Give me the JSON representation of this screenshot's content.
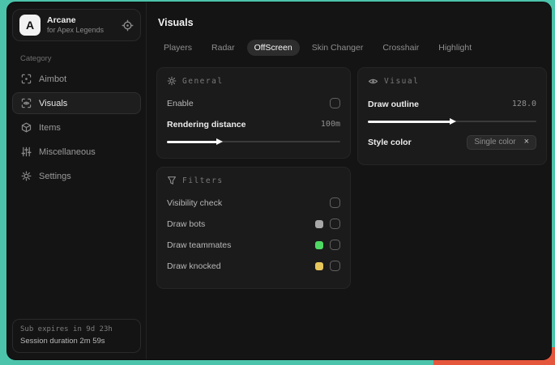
{
  "app": {
    "initial": "A",
    "name": "Arcane",
    "subtitle": "for Apex Legends",
    "header_icon": "target"
  },
  "sidebar": {
    "category_label": "Category",
    "items": [
      {
        "label": "Aimbot",
        "icon": "crosshair",
        "active": false
      },
      {
        "label": "Visuals",
        "icon": "eye-scan",
        "active": true
      },
      {
        "label": "Items",
        "icon": "cube",
        "active": false
      },
      {
        "label": "Miscellaneous",
        "icon": "sliders",
        "active": false
      },
      {
        "label": "Settings",
        "icon": "gear",
        "active": false
      }
    ],
    "footer": {
      "line1": "Sub expires in 9d 23h",
      "line2": "Session duration 2m 59s"
    }
  },
  "main": {
    "title": "Visuals",
    "tabs": [
      {
        "label": "Players",
        "active": false
      },
      {
        "label": "Radar",
        "active": false
      },
      {
        "label": "OffScreen",
        "active": true
      },
      {
        "label": "Skin Changer",
        "active": false
      },
      {
        "label": "Crosshair",
        "active": false
      },
      {
        "label": "Highlight",
        "active": false
      }
    ],
    "general_card": {
      "title": "General",
      "icon": "sun",
      "enable_label": "Enable",
      "enable_checked": false,
      "rendering_label": "Rendering distance",
      "rendering_value": "100m",
      "slider_pct": 30
    },
    "visual_card": {
      "title": "Visual",
      "icon": "eye",
      "outline_label": "Draw outline",
      "outline_value": "128.0",
      "slider_pct": 50,
      "style_label": "Style color",
      "style_value": "Single color",
      "style_clear_icon": "close"
    },
    "filters_card": {
      "title": "Filters",
      "icon": "funnel",
      "rows": [
        {
          "label": "Visibility check",
          "swatch": null,
          "checked": false
        },
        {
          "label": "Draw bots",
          "swatch": "#a8a8a8",
          "checked": false
        },
        {
          "label": "Draw teammates",
          "swatch": "#4fd964",
          "checked": false
        },
        {
          "label": "Draw knocked",
          "swatch": "#e7c75c",
          "checked": false
        }
      ]
    }
  },
  "colors": {
    "desktop_teal": "#4cc4ab",
    "desktop_orange": "#e5573d",
    "window_bg": "#141414",
    "card_bg": "#1b1b1b",
    "accent_green": "#4fd964",
    "accent_yellow": "#e7c75c",
    "accent_gray": "#a8a8a8"
  }
}
